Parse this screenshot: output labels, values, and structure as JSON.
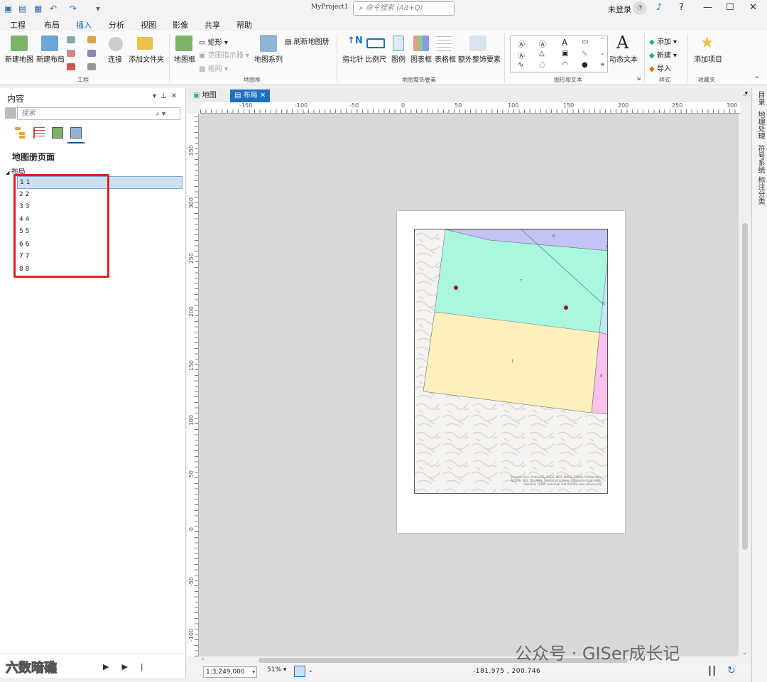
{
  "titlebar": {
    "project": "MyProject1",
    "search_placeholder": "命令搜索 (Alt+Q)",
    "user": "未登录",
    "help": "?",
    "minimize": "—",
    "maximize": "☐",
    "close": "✕"
  },
  "menus": [
    "工程",
    "布局",
    "插入",
    "分析",
    "视图",
    "影像",
    "共享",
    "帮助"
  ],
  "ribbon": {
    "project_group": {
      "label": "工程",
      "new_map": "新建地图",
      "new_layout": "新建布局",
      "connect": "连接",
      "add_folder": "添加文件夹"
    },
    "map_frame_group": {
      "label": "地图框",
      "map_frame": "地图框",
      "rectangle": "矩形",
      "extent_indicator": "范围指示器",
      "grid": "格网",
      "map_series": "地图系列",
      "refresh_series": "刷新地图册"
    },
    "surround_group": {
      "label": "地图整饰要素",
      "north_arrow": "指北针",
      "scale_bar": "比例尺",
      "legend": "图例",
      "chart_frame": "图表框",
      "table_frame": "表格框",
      "extra_surround": "额外整饰要素"
    },
    "graphics_group": {
      "label": "图形和文本",
      "dynamic_text": "动态文本"
    },
    "style_group": {
      "label": "样式",
      "add": "添加",
      "new": "新建",
      "import": "导入"
    },
    "favorites_group": {
      "label": "收藏夹",
      "add_item": "添加项目"
    }
  },
  "contents": {
    "title": "内容",
    "search_placeholder": "搜索",
    "heading": "地图册页面",
    "root": "布局",
    "pages": [
      "1  1",
      "2  2",
      "3  3",
      "4  4",
      "5  5",
      "6  6",
      "7  7",
      "8  8"
    ]
  },
  "doc_tabs": [
    "地图",
    "布局"
  ],
  "hruler": [
    "-150",
    "-100",
    "-50",
    "0",
    "50",
    "100",
    "150",
    "200",
    "250",
    "300"
  ],
  "vruler": [
    "350",
    "300",
    "250",
    "200",
    "150",
    "100",
    "50",
    "0",
    "-50",
    "-100"
  ],
  "map": {
    "labels": [
      "6",
      "7",
      "1",
      "8",
      "4",
      "5"
    ],
    "credit": "Sources: Esri, Airbus DS, USGS, NGA, NASA, CGIAR, N Robinson, NCEAS, NLS, OS, NMA, Geodatastyrelsen, Rijkswaterstaat, GSA, Geoland, FEMA, Intermap and the GIS user community"
  },
  "status": {
    "scale": "1:3,249,000",
    "zoom": "51%",
    "coords": "-181.975 ,  200.746"
  },
  "right_tabs": [
    "目录",
    "地理处理",
    "符号系统",
    "标注分类"
  ],
  "watermarks": {
    "left": "六数暗礁",
    "right": "公众号 · GISer成长记"
  },
  "colors": {
    "accent": "#1e6fc2",
    "selection": "#cde0f3",
    "highlight_box": "#e02020",
    "poly_green": "#aaf7e0",
    "poly_yellow": "#fdf0bd",
    "poly_purple": "#c3c3f5",
    "poly_pink": "#f8c2ec",
    "poly_cyan": "#bfe9f5",
    "point": "#a01010"
  }
}
